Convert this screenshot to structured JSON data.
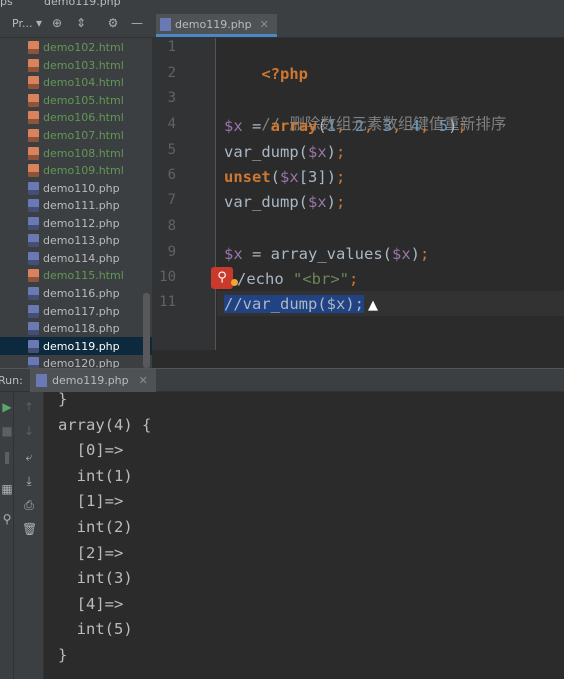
{
  "top": {
    "left_text": "ps",
    "tab_text": "demo119.php"
  },
  "project": {
    "title": "Pr...",
    "files": [
      {
        "name": "demo102.html",
        "type": "html",
        "selected": false
      },
      {
        "name": "demo103.html",
        "type": "html",
        "selected": false
      },
      {
        "name": "demo104.html",
        "type": "html",
        "selected": false
      },
      {
        "name": "demo105.html",
        "type": "html",
        "selected": false
      },
      {
        "name": "demo106.html",
        "type": "html",
        "selected": false
      },
      {
        "name": "demo107.html",
        "type": "html",
        "selected": false
      },
      {
        "name": "demo108.html",
        "type": "html",
        "selected": false
      },
      {
        "name": "demo109.html",
        "type": "html",
        "selected": false
      },
      {
        "name": "demo110.php",
        "type": "php",
        "selected": false
      },
      {
        "name": "demo111.php",
        "type": "php",
        "selected": false
      },
      {
        "name": "demo112.php",
        "type": "php",
        "selected": false
      },
      {
        "name": "demo113.php",
        "type": "php",
        "selected": false
      },
      {
        "name": "demo114.php",
        "type": "php",
        "selected": false
      },
      {
        "name": "demo115.html",
        "type": "html",
        "selected": false
      },
      {
        "name": "demo116.php",
        "type": "php",
        "selected": false
      },
      {
        "name": "demo117.php",
        "type": "php",
        "selected": false
      },
      {
        "name": "demo118.php",
        "type": "php",
        "selected": false
      },
      {
        "name": "demo119.php",
        "type": "php",
        "selected": true
      },
      {
        "name": "demo120.php",
        "type": "php",
        "selected": false
      }
    ]
  },
  "editor": {
    "tab_label": "demo119.php",
    "line_numbers": [
      "1",
      "2",
      "3",
      "4",
      "5",
      "6",
      "7",
      "8",
      "9",
      "10",
      "11"
    ],
    "code": {
      "l1": "<?php",
      "l3": "// 删除数组元素数组键值重新排序",
      "l4_var": "$x",
      "l4_eq": " = ",
      "l4_kw": "array",
      "l4_open": "(",
      "l4_n1": "1",
      "l4_n2": "2",
      "l4_n3": "3",
      "l4_n4": "4",
      "l4_n5": "5",
      "l4_close": ")",
      "l4_comma": ", ",
      "semi": ";",
      "l5_fn": "var_dump(",
      "l5_var": "$x",
      "l5_close": ")",
      "l6_kw": "unset",
      "l6_open": "(",
      "l6_var": "$x",
      "l6_idx": "[3]",
      "l6_close": ")",
      "l7_fn": "var_dump(",
      "l7_var": "$x",
      "l7_close": ")",
      "l9_var": "$x",
      "l9_eq": " = array_values(",
      "l9_var2": "$x",
      "l9_close": ")",
      "l10_text": "/echo ",
      "l10_str": "\"<br>\"",
      "l11_selected": "//var_dump($x);"
    }
  },
  "run": {
    "label": "Run:",
    "tab_label": "demo119.php",
    "output": [
      "}",
      "array(4) {",
      "  [0]=>",
      "  int(1)",
      "  [1]=>",
      "  int(2)",
      "  [2]=>",
      "  int(3)",
      "  [4]=>",
      "  int(5)",
      "}"
    ]
  }
}
